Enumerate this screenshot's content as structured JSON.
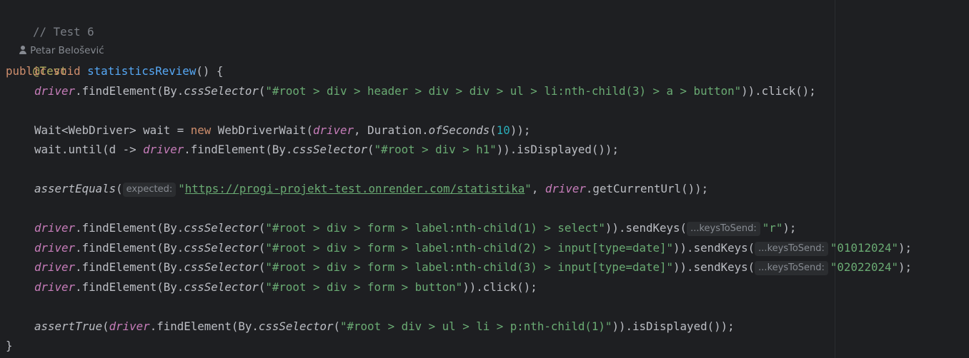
{
  "editor": {
    "comment": "// Test 6",
    "author": "Petar Belošević",
    "annotation": "@Test",
    "method": {
      "kw_public": "public",
      "kw_void": "void",
      "name": "statisticsReview",
      "sig_rest": "() {"
    },
    "hints": {
      "expected": "expected:",
      "keys_to_send": "...keysToSend:"
    },
    "tokens": {
      "driver": "driver",
      "find_by_css": ".findElement(By.",
      "css_selector": "cssSelector",
      "open_paren": "(",
      "click_tail": ")).click();",
      "send_keys_tail": ")).sendKeys(",
      "close_stmt": ");",
      "displayed_tail": ")).isDisplayed());",
      "wait_decl": "Wait<WebDriver> wait = ",
      "kw_new": "new",
      "webdriverwait_open": " WebDriverWait(",
      "duration": ", Duration.",
      "of_seconds": "ofSeconds",
      "seconds": "10",
      "wait_close": "));",
      "wait_until": "wait.until(d -> ",
      "assert_equals": "assertEquals",
      "current_url_tail": ".getCurrentUrl());",
      "comma_space": ", ",
      "assert_true": "assertTrue",
      "find_by_css_inner": ".findElement(By.",
      "close_brace": "}"
    },
    "strings": {
      "header_button": "\"#root > div > header > div > div > ul > li:nth-child(3) > a > button\"",
      "h1": "\"#root > div > h1\"",
      "url_quote": "\"",
      "url": "https://progi-projekt-test.onrender.com/statistika",
      "select": "\"#root > div > form > label:nth-child(1) > select\"",
      "key_r": "\"r\"",
      "date_input_2": "\"#root > div > form > label:nth-child(2) > input[type=date]\"",
      "date_val_2": "\"01012024\"",
      "date_input_3": "\"#root > div > form > label:nth-child(3) > input[type=date]\"",
      "date_val_3": "\"02022024\"",
      "form_button": "\"#root > div > form > button\"",
      "result_p": "\"#root > div > ul > li > p:nth-child(1)\""
    }
  }
}
